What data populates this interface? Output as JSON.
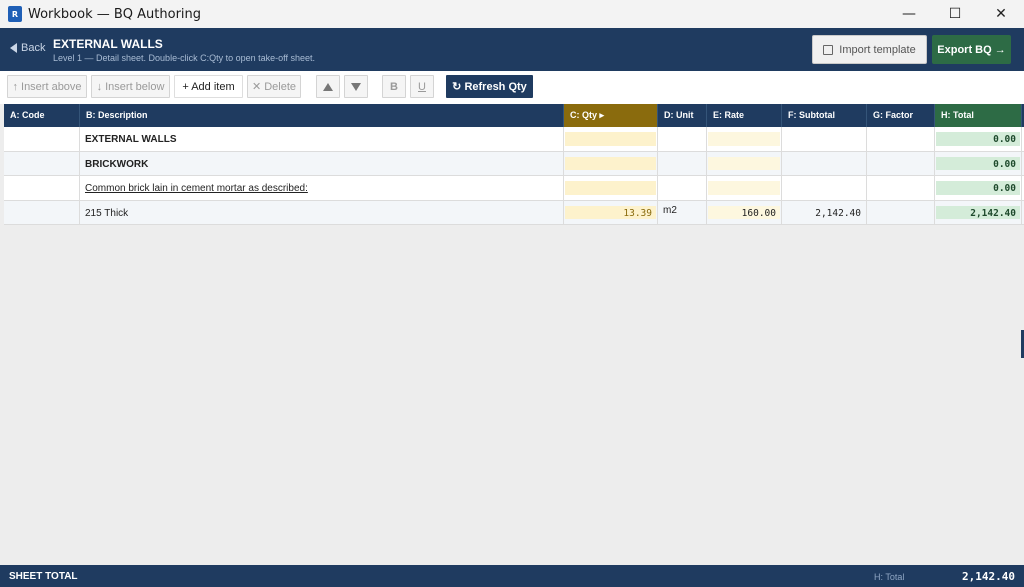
{
  "window": {
    "app_icon_text": "R",
    "title": "Workbook — BQ Authoring",
    "minimize_glyph": "—",
    "maximize_glyph": "☐",
    "close_glyph": "✕"
  },
  "header": {
    "back_label": "Back",
    "title": "EXTERNAL WALLS",
    "subtitle": "Level 1 — Detail sheet. Double-click C:Qty to open take-off sheet.",
    "import_label": "Import template",
    "export_label": "Export BQ →"
  },
  "toolbar": {
    "insert_above": "↑ Insert above",
    "insert_below": "↓ Insert below",
    "add_item": "+ Add item",
    "delete": "✕ Delete",
    "bold": "B",
    "underline": "U",
    "refresh": "↻ Refresh Qty"
  },
  "columns": {
    "code": "A: Code",
    "description": "B: Description",
    "qty": "C: Qty ▸",
    "unit": "D: Unit",
    "rate": "E: Rate",
    "subtotal": "F: Subtotal",
    "factor": "G: Factor",
    "total": "H: Total"
  },
  "rows": [
    {
      "code": "",
      "description": "EXTERNAL WALLS",
      "qty": "",
      "unit": "",
      "rate": "",
      "subtotal": "",
      "factor": "",
      "total": "0.00"
    },
    {
      "code": "",
      "description": "BRICKWORK",
      "qty": "",
      "unit": "",
      "rate": "",
      "subtotal": "",
      "factor": "",
      "total": "0.00"
    },
    {
      "code": "",
      "description": "Common brick lain in cement mortar as described:",
      "qty": "",
      "unit": "",
      "rate": "",
      "subtotal": "",
      "factor": "",
      "total": "0.00"
    },
    {
      "code": "",
      "description": "215 Thick",
      "qty": "13.39",
      "unit": "m2",
      "rate": "160.00",
      "subtotal": "2,142.40",
      "factor": "",
      "total": "2,142.40"
    }
  ],
  "status": {
    "label": "SHEET TOTAL",
    "htotal_label": "H: Total",
    "value": "2,142.40"
  },
  "colors": {
    "navy": "#1f3b60",
    "qty_accent": "#8a6b0d",
    "total_accent": "#2d6b45"
  }
}
